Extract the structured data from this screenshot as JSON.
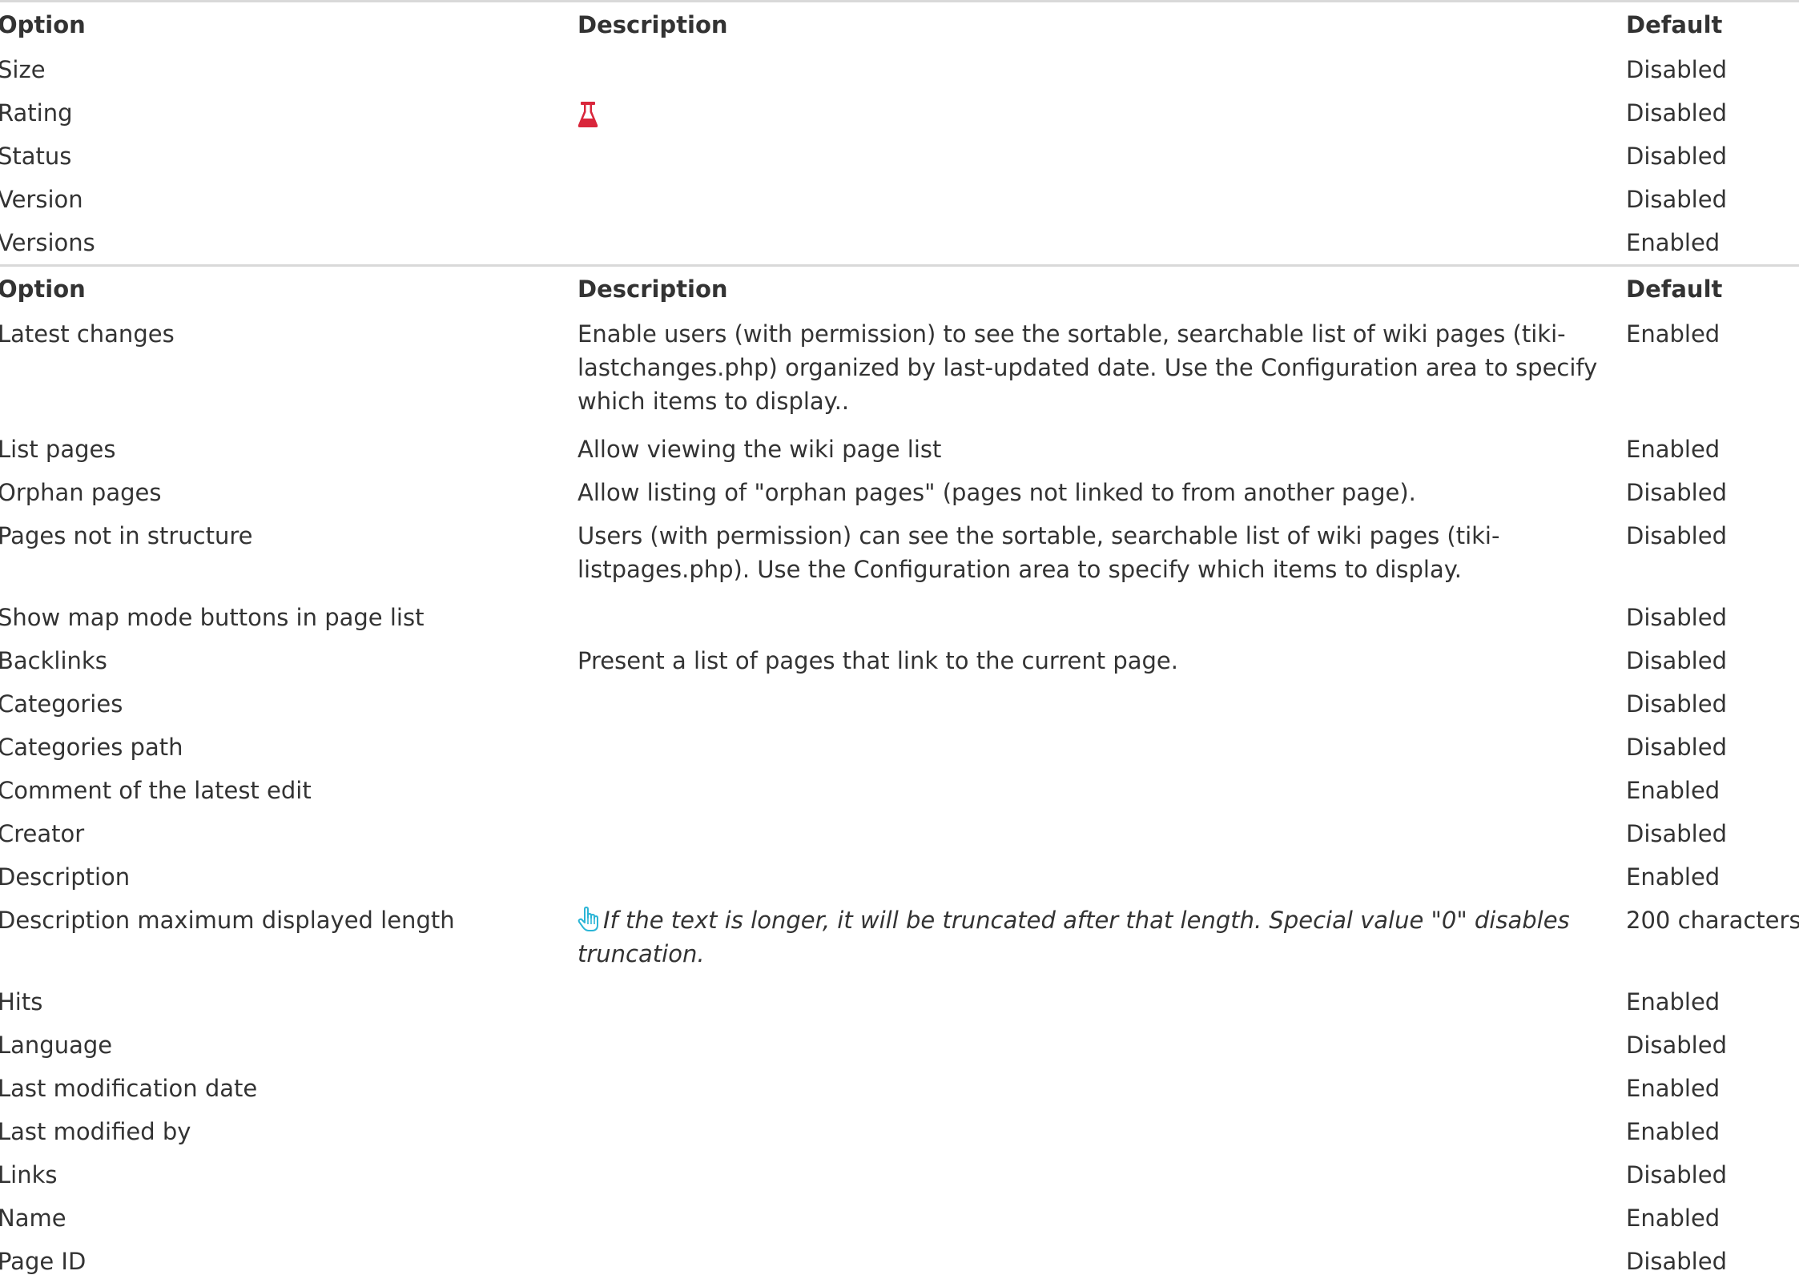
{
  "table1": {
    "headers": {
      "option": "Option",
      "description": "Description",
      "default": "Default"
    },
    "rows": [
      {
        "option": "Size",
        "description": "",
        "default": "Disabled"
      },
      {
        "option": "Rating",
        "description": "",
        "icon": "experimental-flask-icon",
        "default": "Disabled"
      },
      {
        "option": "Status",
        "description": "",
        "default": "Disabled"
      },
      {
        "option": "Version",
        "description": "",
        "default": "Disabled"
      },
      {
        "option": "Versions",
        "description": "",
        "default": "Enabled"
      }
    ]
  },
  "table2": {
    "headers": {
      "option": "Option",
      "description": "Description",
      "default": "Default"
    },
    "rows": [
      {
        "option": "Latest changes",
        "description": "Enable users (with permission) to see the sortable, searchable list of wiki pages (tiki-lastchanges.php) organized by last-updated date. Use the Configuration area to specify which items to display..",
        "default": "Enabled"
      },
      {
        "option": "List pages",
        "description": "Allow viewing the wiki page list",
        "default": "Enabled"
      },
      {
        "option": "Orphan pages",
        "description": "Allow listing of \"orphan pages\" (pages not linked to from another page).",
        "default": "Disabled"
      },
      {
        "option": "Pages not in structure",
        "description": "Users (with permission) can see the sortable, searchable list of wiki pages (tiki-listpages.php). Use the Configuration area to specify which items to display.",
        "default": "Disabled"
      },
      {
        "option": "Show map mode buttons in page list",
        "description": "",
        "default": "Disabled"
      },
      {
        "option": "Backlinks",
        "description": "Present a list of pages that link to the current page.",
        "default": "Disabled"
      },
      {
        "option": "Categories",
        "description": "",
        "default": "Disabled"
      },
      {
        "option": "Categories path",
        "description": "",
        "default": "Disabled"
      },
      {
        "option": "Comment of the latest edit",
        "description": "",
        "default": "Enabled"
      },
      {
        "option": "Creator",
        "description": "",
        "default": "Disabled"
      },
      {
        "option": "Description",
        "description": "",
        "default": "Enabled"
      },
      {
        "option": "Description maximum displayed length",
        "description": "If the text is longer, it will be truncated after that length. Special value \"0\" disables truncation.",
        "icon": "hand-pointer-icon",
        "default": "200 characters"
      },
      {
        "option": "Hits",
        "description": "",
        "default": "Enabled"
      },
      {
        "option": "Language",
        "description": "",
        "default": "Disabled"
      },
      {
        "option": "Last modification date",
        "description": "",
        "default": "Enabled"
      },
      {
        "option": "Last modified by",
        "description": "",
        "default": "Enabled"
      },
      {
        "option": "Links",
        "description": "",
        "default": "Disabled"
      },
      {
        "option": "Name",
        "description": "",
        "default": "Enabled"
      },
      {
        "option": "Page ID",
        "description": "",
        "default": "Disabled"
      }
    ]
  },
  "colors": {
    "text": "#333333",
    "flask_icon": "#d9263b",
    "hand_icon": "#2bb5d6",
    "divider": "#d9d9d9"
  }
}
